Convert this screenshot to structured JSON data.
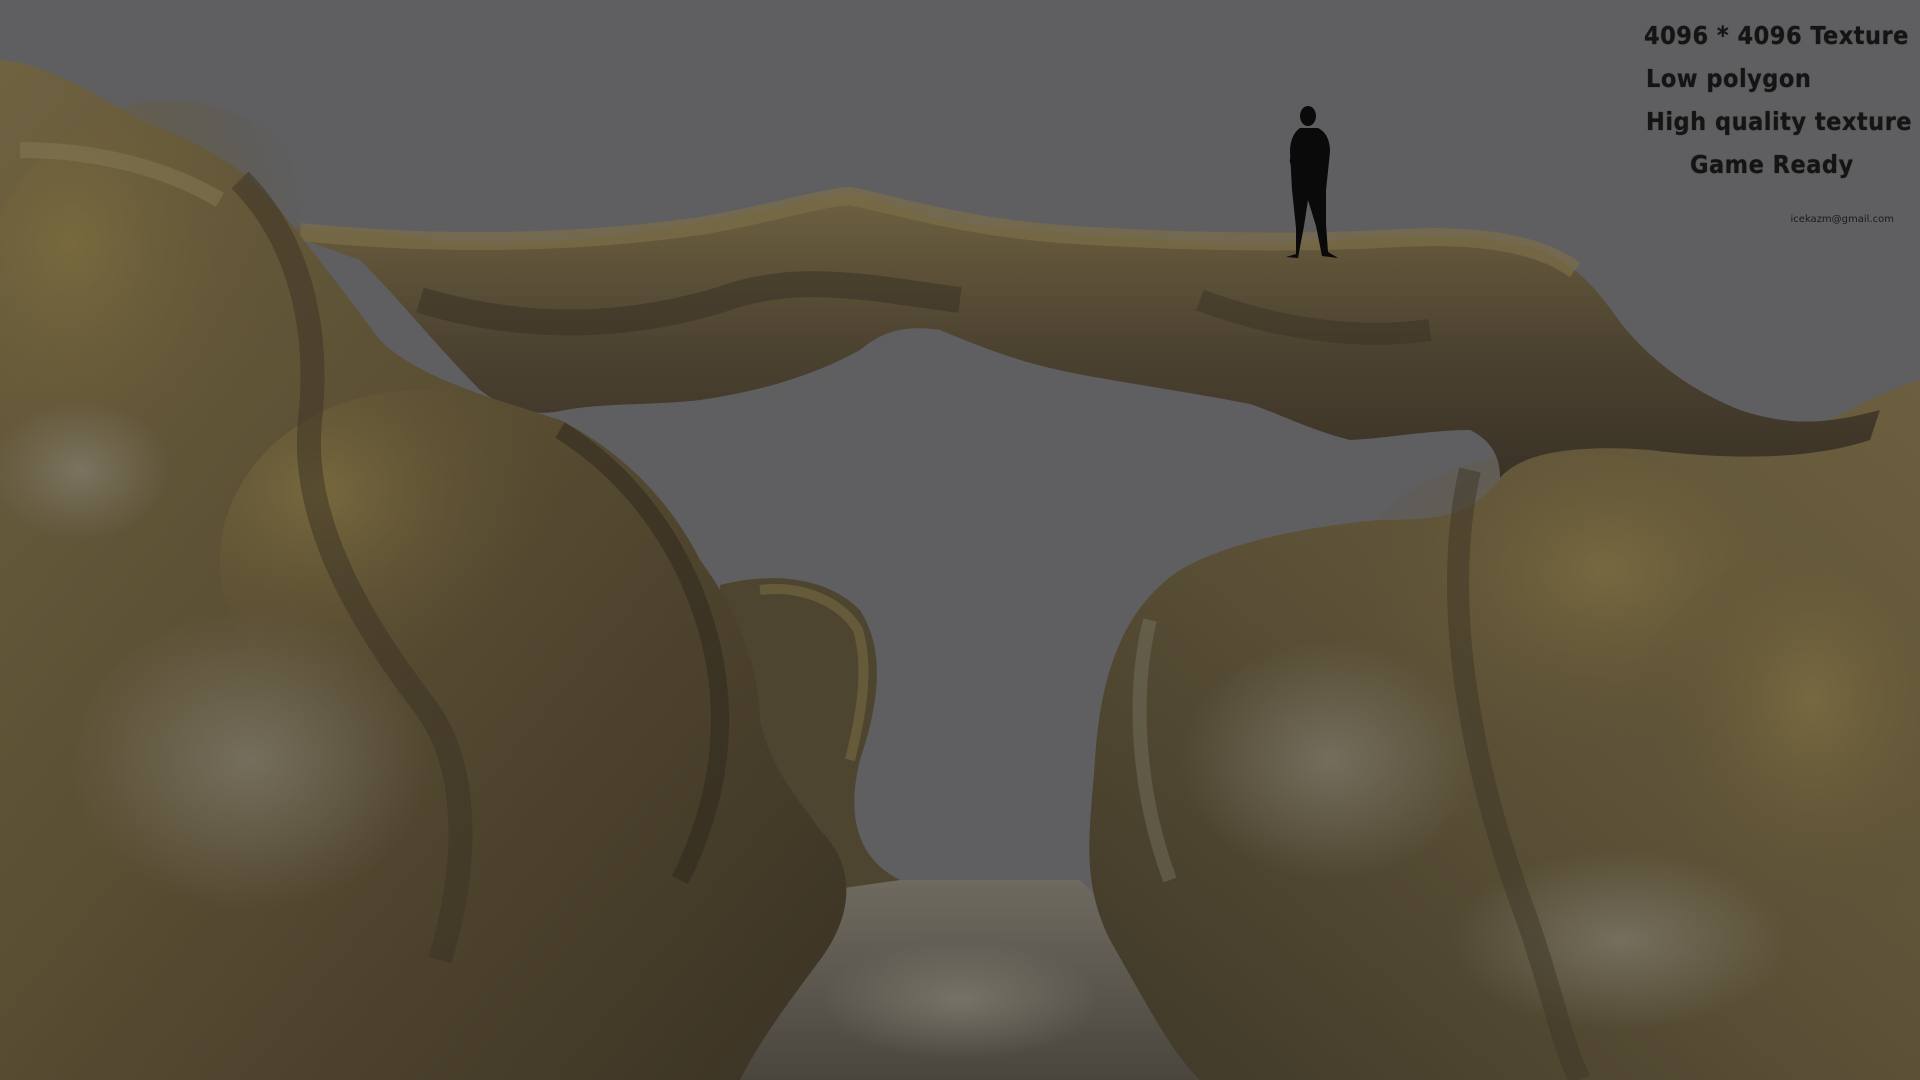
{
  "overlay": {
    "lines": [
      "4096 * 4096 Texture",
      "Low polygon",
      "High quality texture",
      "Game Ready"
    ],
    "email": "icekazm@gmail.com"
  },
  "scene": {
    "background_color": "#5f5f61",
    "rock_colors": [
      "#5b5034",
      "#6f6140",
      "#3f3524",
      "#7d7a6c"
    ],
    "subject": "rock-arch-3d-model",
    "figure": "human-silhouette-scale-reference"
  }
}
